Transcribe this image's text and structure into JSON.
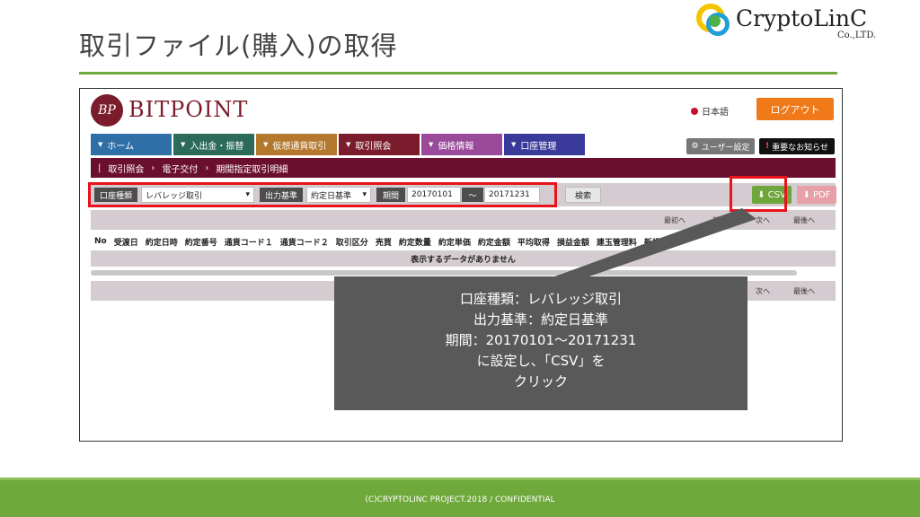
{
  "slide": {
    "title": "取引ファイル(購入)の取得",
    "logo_text": "CryptoLinC",
    "logo_sub": "Co.,LTD.",
    "footer": "(C)CRYPTOLINC PROJECT.2018 / CONFIDENTIAL"
  },
  "app": {
    "brand_mark": "BP",
    "brand_name": "BITPOINT",
    "language": "日本語",
    "logout_label": "ログアウト",
    "menu": [
      {
        "label": "ホーム",
        "color": "#2f6fa8"
      },
      {
        "label": "入出金・振替",
        "color": "#2c6b5a"
      },
      {
        "label": "仮想通貨取引",
        "color": "#b4782c"
      },
      {
        "label": "取引照会",
        "color": "#7a1c2c"
      },
      {
        "label": "価格情報",
        "color": "#9a4a9a"
      },
      {
        "label": "口座管理",
        "color": "#3a3a9a"
      }
    ],
    "user_settings_label": "ユーザー設定",
    "notice_label": "重要なお知らせ",
    "breadcrumb": [
      "取引照会",
      "電子交付",
      "期間指定取引明細"
    ],
    "filter": {
      "account_type_label": "口座種類",
      "account_type_value": "レバレッジ取引",
      "output_basis_label": "出力基準",
      "output_basis_value": "約定日基準",
      "period_label": "期間",
      "period_from": "20170101",
      "tilde": "〜",
      "period_to": "20171231",
      "search_label": "検索",
      "csv_label": "CSV",
      "pdf_label": "PDF"
    },
    "pager_top": {
      "first": "最初へ",
      "prev": "前へ",
      "next": "次へ",
      "last": "最後へ"
    },
    "pager_bottom": {
      "next": "次へ",
      "last": "最後へ"
    },
    "columns": [
      "No",
      "受渡日",
      "約定日時",
      "約定番号",
      "通貨コード１",
      "通貨コード２",
      "取引区分",
      "売買",
      "約定数量",
      "約定単価",
      "約定金額",
      "平均取得",
      "損益金額",
      "建玉管理料",
      "新規"
    ],
    "empty_message": "表示するデータがありません"
  },
  "callout": {
    "lines": [
      "口座種類：レバレッジ取引",
      "出力基準：約定日基準",
      "期間：20170101〜20171231",
      "に設定し、「CSV」を",
      "クリック"
    ]
  },
  "colors": {
    "accent_green": "#6fa83b",
    "brand_maroon": "#7a1c2c",
    "highlight_red": "#e8131b",
    "callout_gray": "#595959"
  }
}
